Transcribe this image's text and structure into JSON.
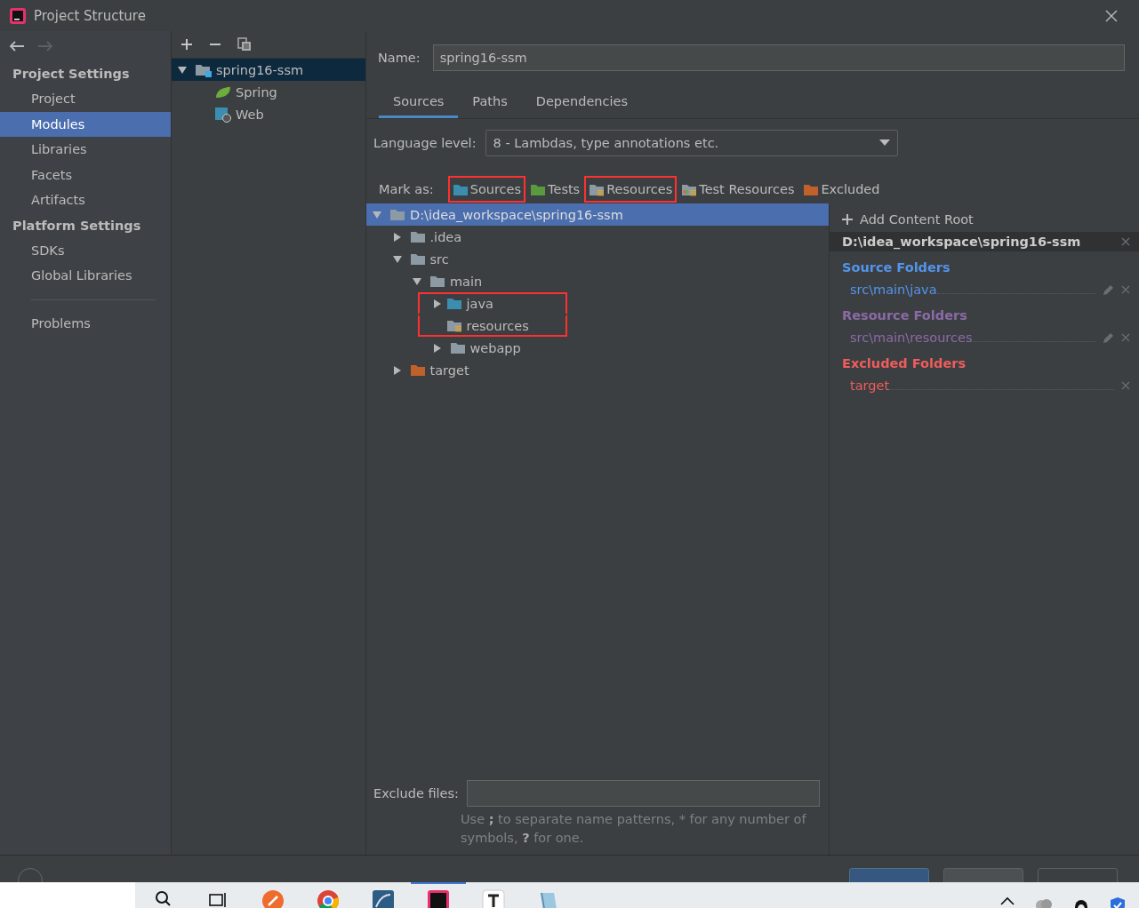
{
  "window": {
    "title": "Project Structure"
  },
  "sidebar": {
    "groups": [
      {
        "heading": "Project Settings",
        "items": [
          {
            "label": "Project",
            "selected": false
          },
          {
            "label": "Modules",
            "selected": true
          },
          {
            "label": "Libraries",
            "selected": false
          },
          {
            "label": "Facets",
            "selected": false
          },
          {
            "label": "Artifacts",
            "selected": false
          }
        ]
      },
      {
        "heading": "Platform Settings",
        "items": [
          {
            "label": "SDKs",
            "selected": false
          },
          {
            "label": "Global Libraries",
            "selected": false
          }
        ]
      }
    ],
    "extra_items": [
      {
        "label": "Problems",
        "selected": false
      }
    ]
  },
  "modules": {
    "tree": [
      {
        "label": "spring16-ssm",
        "kind": "module",
        "selected": true,
        "expanded": true,
        "children": [
          {
            "label": "Spring",
            "kind": "spring",
            "selected": false
          },
          {
            "label": "Web",
            "kind": "web",
            "selected": false
          }
        ]
      }
    ]
  },
  "module": {
    "name_label": "Name:",
    "name": "spring16-ssm",
    "tabs": [
      {
        "label": "Sources",
        "selected": true
      },
      {
        "label": "Paths",
        "selected": false
      },
      {
        "label": "Dependencies",
        "selected": false
      }
    ],
    "language_label": "Language level:",
    "language_level": "8 - Lambdas, type annotations etc.",
    "mark_as_label": "Mark as:",
    "mark_as": [
      {
        "label": "Sources",
        "kind": "sources",
        "highlighted": true
      },
      {
        "label": "Tests",
        "kind": "tests",
        "highlighted": false
      },
      {
        "label": "Resources",
        "kind": "resources",
        "highlighted": true
      },
      {
        "label": "Test Resources",
        "kind": "test-resources",
        "highlighted": false
      },
      {
        "label": "Excluded",
        "kind": "excluded",
        "highlighted": false
      }
    ],
    "tree": [
      {
        "label": "D:\\idea_workspace\\spring16-ssm",
        "kind": "folder",
        "selected": true,
        "expanded": true,
        "highlighted": false,
        "children": [
          {
            "label": ".idea",
            "kind": "folder",
            "selected": false,
            "expanded": false,
            "highlighted": false
          },
          {
            "label": "src",
            "kind": "folder",
            "selected": false,
            "expanded": true,
            "highlighted": false,
            "children": [
              {
                "label": "main",
                "kind": "folder",
                "selected": false,
                "expanded": true,
                "highlighted": false,
                "children": [
                  {
                    "label": "java",
                    "kind": "sources",
                    "selected": false,
                    "expanded": false,
                    "highlighted": true
                  },
                  {
                    "label": "resources",
                    "kind": "resources",
                    "selected": false,
                    "highlighted": true
                  },
                  {
                    "label": "webapp",
                    "kind": "folder",
                    "selected": false,
                    "expanded": false,
                    "highlighted": false
                  }
                ]
              }
            ]
          },
          {
            "label": "target",
            "kind": "excluded",
            "selected": false,
            "expanded": false,
            "highlighted": false
          }
        ]
      }
    ],
    "exclude_label": "Exclude files:",
    "exclude_hint": "Use **;** to separate name patterns, * for any number of symbols, **?** for one.",
    "content_root": {
      "action": "Add Content Root",
      "path": "D:\\idea_workspace\\spring16-ssm",
      "groups": [
        {
          "heading": "Source Folders",
          "color": "#5394ec",
          "editable": true,
          "folders": [
            "src\\main\\java"
          ]
        },
        {
          "heading": "Resource Folders",
          "color": "#8b6aa7",
          "editable": true,
          "folders": [
            "src\\main\\resources"
          ]
        },
        {
          "heading": "Excluded Folders",
          "color": "#ef5c5c",
          "editable": false,
          "folders": [
            "target"
          ]
        }
      ]
    }
  },
  "buttons": [
    {
      "kind": "default"
    },
    {
      "kind": "normal"
    },
    {
      "kind": "disabled"
    }
  ],
  "taskbar": {
    "apps": [
      {
        "kind": "search",
        "selected": false
      },
      {
        "kind": "taskview",
        "selected": false
      },
      {
        "kind": "postman",
        "selected": false
      },
      {
        "kind": "chrome",
        "selected": false
      },
      {
        "kind": "mysql",
        "selected": false
      },
      {
        "kind": "idea",
        "selected": true
      },
      {
        "kind": "typora",
        "selected": false
      },
      {
        "kind": "notepad",
        "selected": false
      }
    ]
  }
}
